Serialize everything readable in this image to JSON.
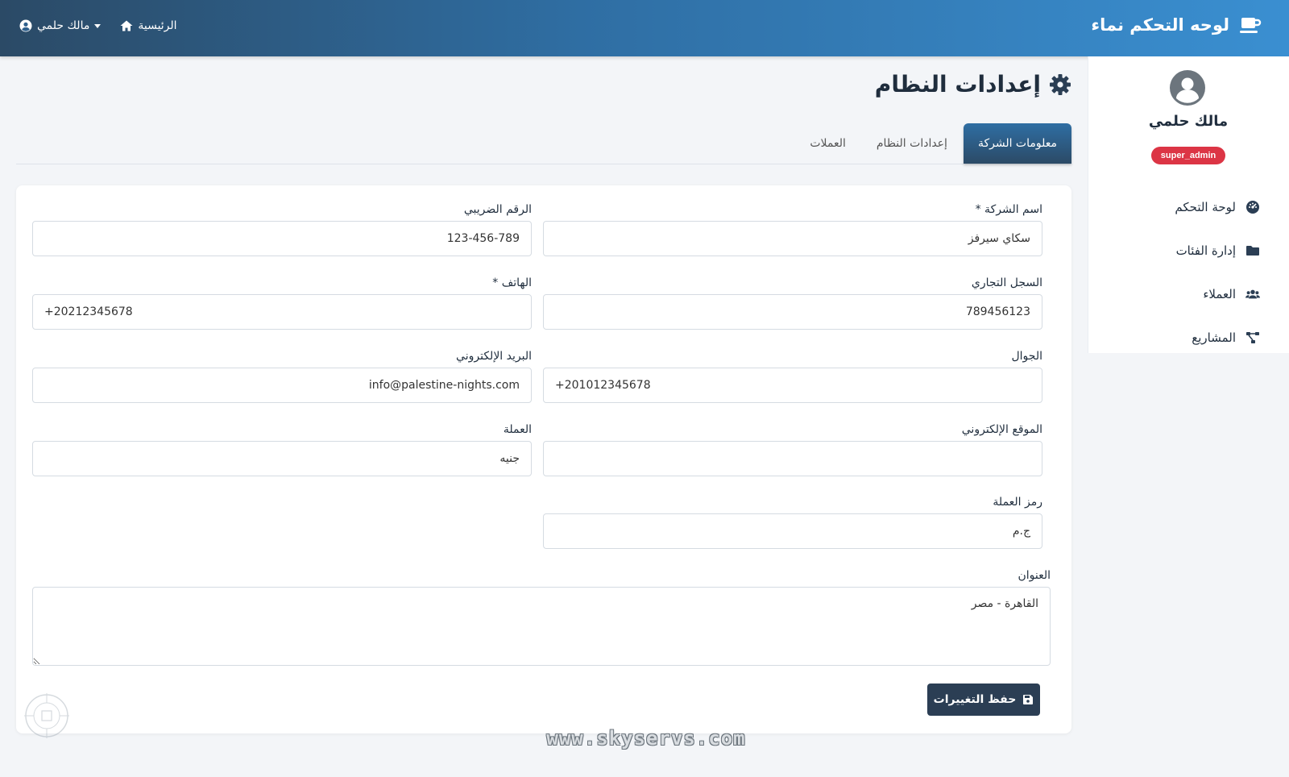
{
  "header": {
    "brand": "لوحه التحكم نماء",
    "home_label": "الرئيسية",
    "user_label": "مالك حلمي"
  },
  "sidebar": {
    "user_name": "مالك حلمي",
    "role": "super_admin",
    "items": [
      {
        "label": "لوحة التحكم",
        "icon": "dashboard-icon"
      },
      {
        "label": "إدارة الفئات",
        "icon": "folder-icon"
      },
      {
        "label": "العملاء",
        "icon": "users-icon"
      },
      {
        "label": "المشاريع",
        "icon": "project-diagram-icon"
      }
    ]
  },
  "page": {
    "title": "إعدادات النظام",
    "tabs": [
      {
        "label": "معلومات الشركة",
        "active": true
      },
      {
        "label": "إعدادات النظام",
        "active": false
      },
      {
        "label": "العملات",
        "active": false
      }
    ]
  },
  "form": {
    "company_name": {
      "label": "اسم الشركة *",
      "value": "سكاي سيرفز"
    },
    "tax_number": {
      "label": "الرقم الضريبي",
      "value": "123-456-789"
    },
    "commercial_register": {
      "label": "السجل التجاري",
      "value": "789456123"
    },
    "phone": {
      "label": "الهاتف *",
      "value": "+20212345678"
    },
    "mobile": {
      "label": "الجوال",
      "value": "+201012345678"
    },
    "email": {
      "label": "البريد الإلكتروني",
      "value": "info@palestine-nights.com"
    },
    "website": {
      "label": "الموقع الإلكتروني",
      "value": ""
    },
    "currency": {
      "label": "العملة",
      "value": "جنيه"
    },
    "currency_symbol": {
      "label": "رمز العملة",
      "value": "ج.م"
    },
    "address": {
      "label": "العنوان",
      "value": "القاهرة - مصر"
    },
    "save_label": "حفظ التغييرات"
  },
  "watermark": {
    "text": "www.skyservs.com"
  },
  "colors": {
    "accent": "#2f6ea3",
    "dark": "#2b3e54",
    "badge": "#dc3545"
  }
}
